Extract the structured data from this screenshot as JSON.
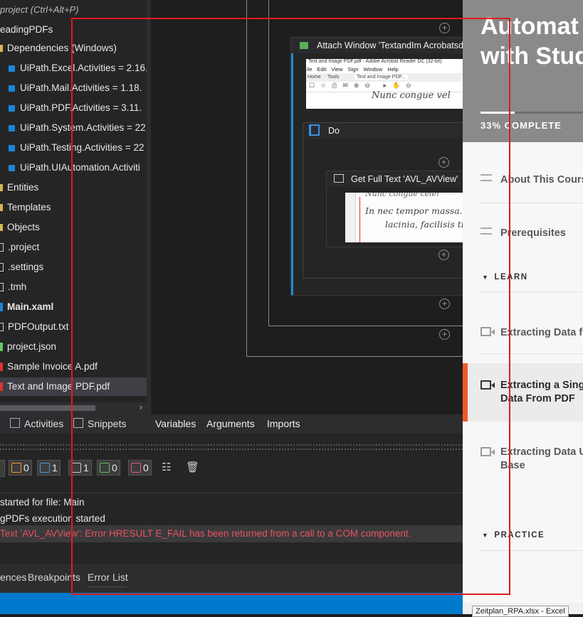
{
  "project_panel": {
    "search_hint": "project (Ctrl+Alt+P)",
    "root": "eadingPDFs",
    "items": [
      {
        "label": "Dependencies (Windows)",
        "kind": "folder"
      },
      {
        "label": "UiPath.Excel.Activities = 2.16.",
        "kind": "package"
      },
      {
        "label": "UiPath.Mail.Activities = 1.18.",
        "kind": "package"
      },
      {
        "label": "UiPath.PDF.Activities = 3.11.",
        "kind": "package"
      },
      {
        "label": "UiPath.System.Activities = 22",
        "kind": "package"
      },
      {
        "label": "UiPath.Testing.Activities = 22",
        "kind": "package"
      },
      {
        "label": "UiPath.UIAutomation.Activiti",
        "kind": "package"
      },
      {
        "label": "Entities",
        "kind": "folder"
      },
      {
        "label": "Templates",
        "kind": "folder"
      },
      {
        "label": "Objects",
        "kind": "folder"
      },
      {
        "label": ".project",
        "kind": "file"
      },
      {
        "label": ".settings",
        "kind": "file"
      },
      {
        "label": ".tmh",
        "kind": "file"
      },
      {
        "label": "Main.xaml",
        "kind": "xaml"
      },
      {
        "label": "PDFOutput.txt",
        "kind": "file"
      },
      {
        "label": "project.json",
        "kind": "json"
      },
      {
        "label": "Sample Invoice A.pdf",
        "kind": "pdf"
      },
      {
        "label": "Text and Image PDF.pdf",
        "kind": "pdf"
      }
    ],
    "tabs": {
      "activities": "Activities",
      "snippets": "Snippets"
    }
  },
  "designer": {
    "attach_window": "Attach Window 'TextandIm Acrobatsd'",
    "do_label": "Do",
    "get_full_text": "Get Full Text 'AVL_AVView'",
    "thumb_title": "Text and Image PDF.pdf - Adobe Acrobat Reader DC (32-bit)",
    "thumb_menu": [
      "ile",
      "Edit",
      "View",
      "Sign",
      "Window",
      "Help"
    ],
    "thumb_tabs": [
      "Home",
      "Tools",
      "Text and Image PDF..."
    ],
    "thumb_text": "Nunc congue vel",
    "thumb2_text1": "Nunc congue celer",
    "thumb2_text2": "In nec tempor massa. Sed",
    "thumb2_text3": "lacinia, facilisis tinc",
    "tabs": {
      "variables": "Variables",
      "arguments": "Arguments",
      "imports": "Imports"
    }
  },
  "output": {
    "filters": [
      {
        "count": "0",
        "color": "#e8a020"
      },
      {
        "count": "1",
        "color": "#4a9be0"
      },
      {
        "count": "1",
        "color": "#cccccc"
      },
      {
        "count": "0",
        "color": "#5cc05c"
      },
      {
        "count": "0",
        "color": "#e05c7a"
      }
    ],
    "lines": [
      "started for file: Main",
      "gPDFs execution started"
    ],
    "error": " Text 'AVL_AVView': Error HRESULT E_FAIL has been returned from a call to a COM component.",
    "tabs": {
      "references": "ences",
      "breakpoints": "Breakpoints",
      "errors": "Error List"
    }
  },
  "course": {
    "title_line1": "Automat",
    "title_line2": "with Stud",
    "progress_text": "33% COMPLETE",
    "progress": 0.33,
    "items": [
      {
        "label": "About This Cours",
        "icon": "lines-icon"
      },
      {
        "label": "Prerequisites",
        "icon": "lines-icon"
      }
    ],
    "section_learn": "LEARN",
    "lessons": [
      {
        "line1": "Extracting Data f",
        "line2": ""
      },
      {
        "line1": "Extracting a Sing",
        "line2": "Data From PDF"
      },
      {
        "line1": "Extracting Data U",
        "line2": "Base"
      }
    ],
    "section_practice": "PRACTICE"
  },
  "taskbar_tooltip": "Zeitplan_RPA.xlsx - Excel"
}
